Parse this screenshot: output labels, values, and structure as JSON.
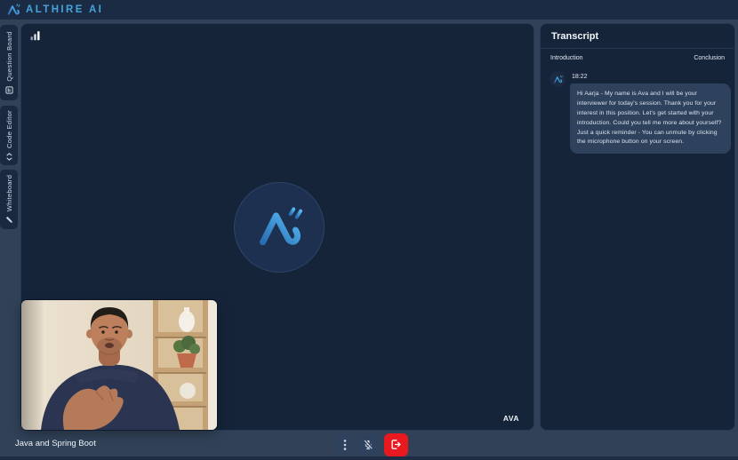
{
  "header": {
    "brand": "ALTHIRE AI",
    "logo_icon": "althire-logo-icon"
  },
  "sidebar": {
    "items": [
      {
        "label": "Question Board",
        "icon": "board-icon"
      },
      {
        "label": "Code Editor",
        "icon": "code-icon"
      },
      {
        "label": "Whiteboard",
        "icon": "pen-icon"
      }
    ]
  },
  "stage": {
    "connection_icon": "signal-bars-icon",
    "center_logo_icon": "althire-logo-icon",
    "speaker_label": "AVA"
  },
  "transcript": {
    "title": "Transcript",
    "sections": [
      {
        "label": "Introduction"
      },
      {
        "label": "Conclusion"
      }
    ],
    "messages": [
      {
        "time": "18:22",
        "avatar_icon": "althire-logo-icon",
        "text": "Hi Aarja - My name is Ava and I will be your interviewer for today's session. Thank you for your interest in this position. Let's get started with your introduction. Could you tell me more about yourself? Just a quick reminder - You can unmute by clicking the microphone button on your screen."
      }
    ]
  },
  "footer": {
    "session_title": "Java and Spring Boot",
    "controls": [
      {
        "icon": "kebab-menu-icon"
      },
      {
        "icon": "mic-off-icon",
        "state": "muted"
      },
      {
        "icon": "leave-call-icon"
      }
    ]
  },
  "colors": {
    "accent_blue": "#44A4DC",
    "danger_red": "#E8191F",
    "page_bg": "#314258",
    "panel_bg": "#16243A",
    "pill_bg": "#1B2940",
    "bubble_bg": "#2E425E"
  }
}
